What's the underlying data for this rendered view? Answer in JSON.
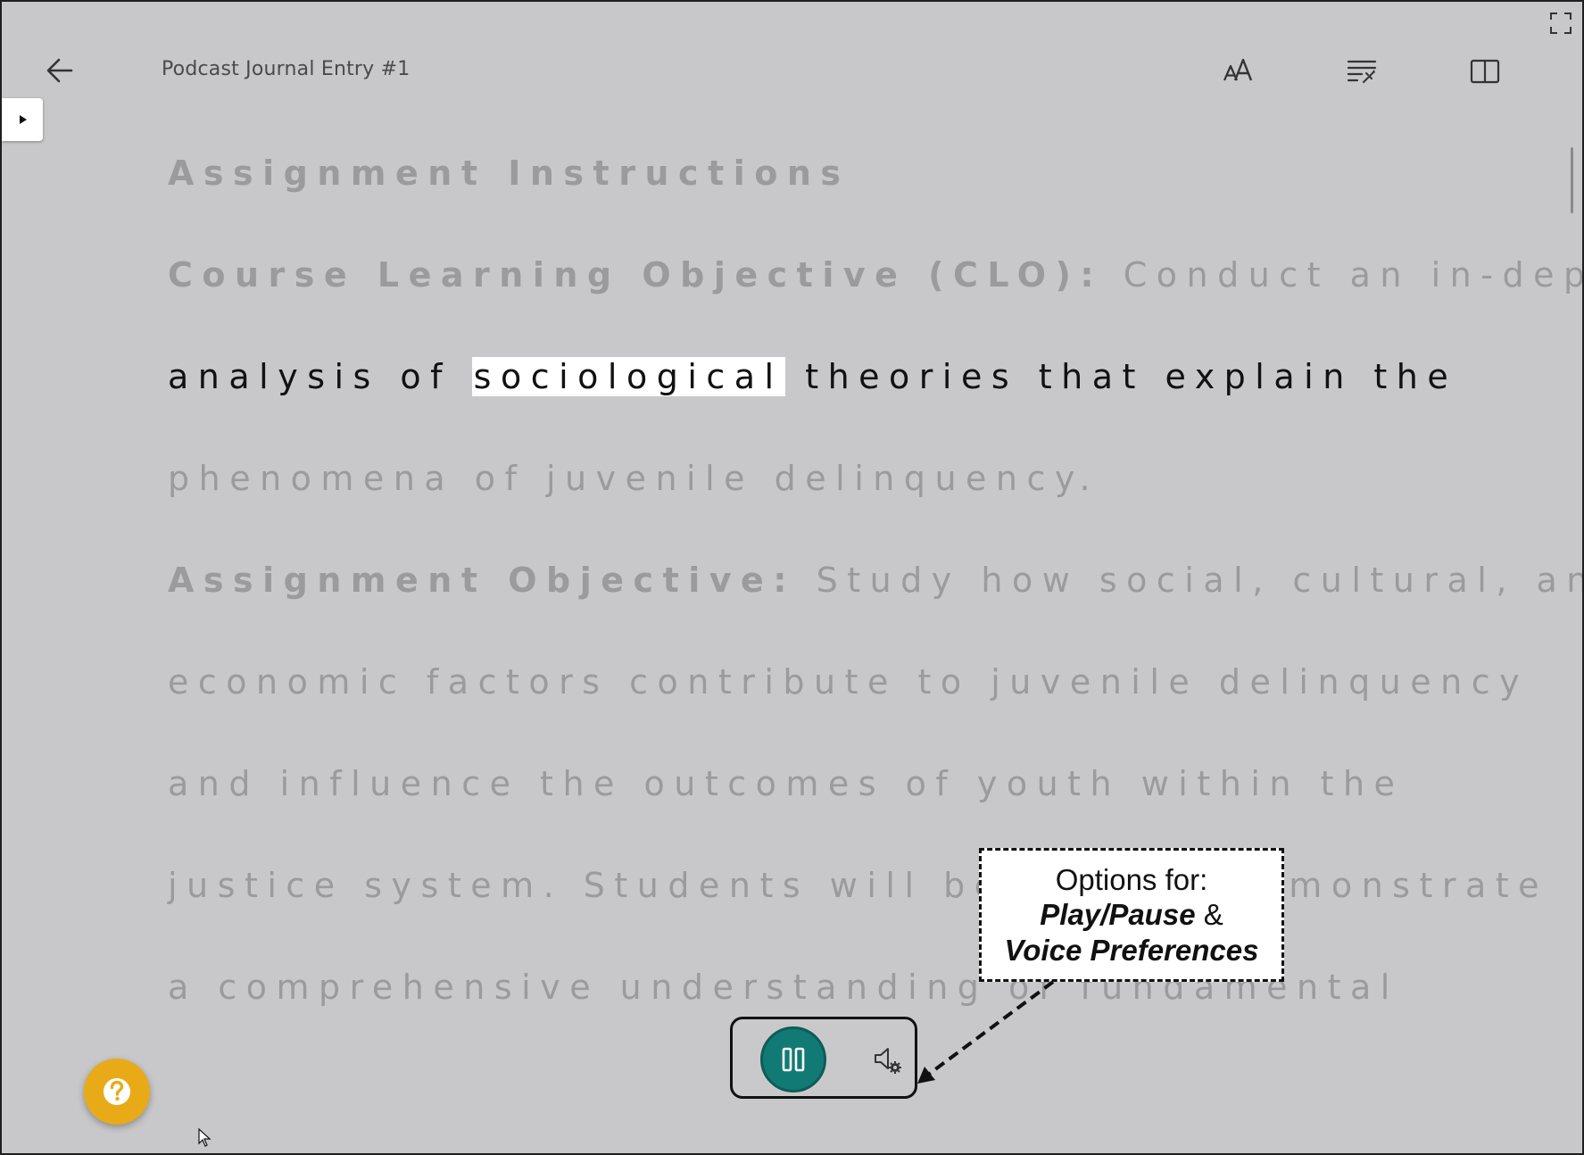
{
  "header": {
    "title": "Podcast Journal Entry #1",
    "back_icon": "arrow-left-icon",
    "tools": [
      "text-size-icon",
      "reading-preferences-icon",
      "split-view-icon"
    ],
    "fullscreen_icon": "fullscreen-icon"
  },
  "sidebar_toggle_icon": "caret-right-icon",
  "content": {
    "heading": "Assignment Instructions",
    "clo_label": "Course Learning Objective (CLO):",
    "clo_text_1": " Conduct an in-depth",
    "active_line": {
      "before": "analysis of ",
      "highlight": "sociological",
      "after": " theories that explain the"
    },
    "line_4": "phenomena of juvenile delinquency.",
    "ao_label": "Assignment Objective:",
    "ao_text_1": " Study how social, cultural, and",
    "line_6": "economic factors contribute to juvenile delinquency",
    "line_7": "and influence the outcomes of youth within the",
    "line_8": "justice system. Students will be able to demonstrate",
    "line_9": "a comprehensive understanding of fundamental"
  },
  "player": {
    "pause_icon": "pause-icon",
    "voice_icon": "voice-settings-icon"
  },
  "help_icon": "help-question-icon",
  "callout": {
    "line1": "Options for:",
    "play_pause": "Play/Pause",
    "amp": " &",
    "voice_prefs": "Voice Preferences"
  },
  "colors": {
    "background": "#c8c8cb",
    "accent_teal": "#127a74",
    "help_yellow": "#e8ab17",
    "dim_text": "#9b9b9d",
    "active_text": "#111111"
  }
}
